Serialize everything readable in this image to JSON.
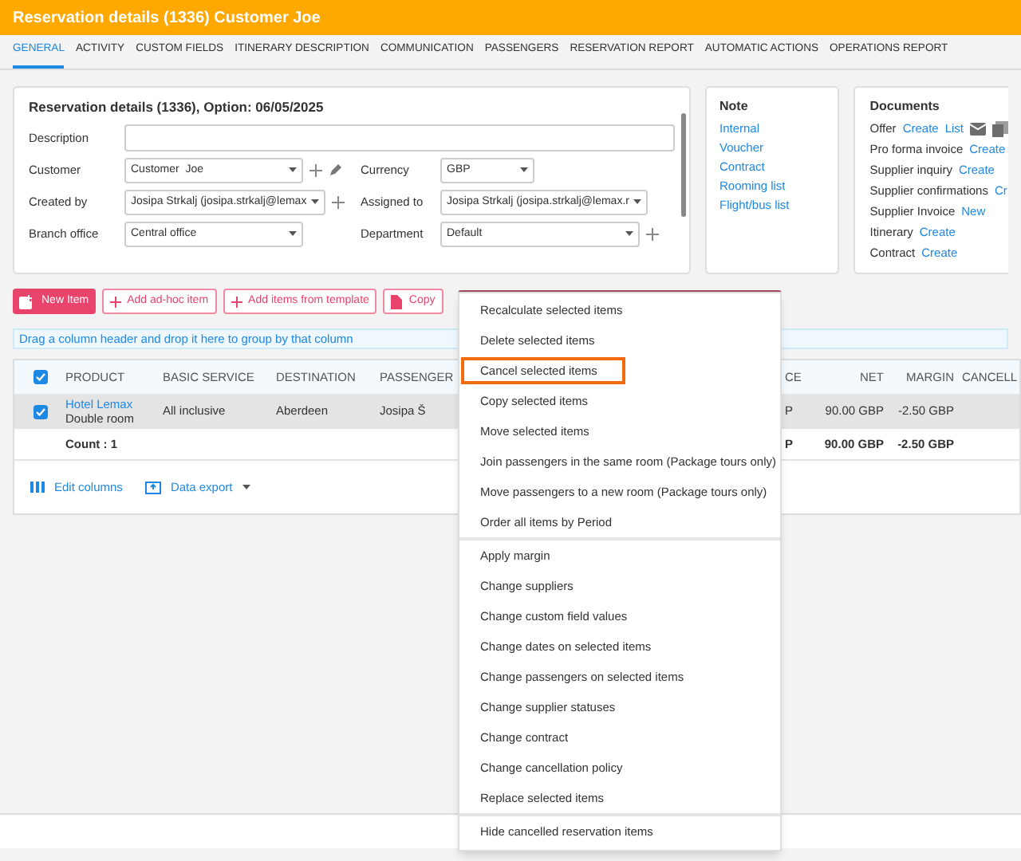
{
  "window": {
    "title": "Reservation details (1336) Customer Joe"
  },
  "tabs": [
    {
      "label": "GENERAL",
      "selected": true
    },
    {
      "label": "ACTIVITY",
      "selected": false
    },
    {
      "label": "CUSTOM FIELDS",
      "selected": false
    },
    {
      "label": "ITINERARY DESCRIPTION",
      "selected": false
    },
    {
      "label": "COMMUNICATION",
      "selected": false
    },
    {
      "label": "PASSENGERS",
      "selected": false
    },
    {
      "label": "RESERVATION REPORT",
      "selected": false
    },
    {
      "label": "AUTOMATIC ACTIONS",
      "selected": false
    },
    {
      "label": "OPERATIONS REPORT",
      "selected": false
    }
  ],
  "details": {
    "title": "Reservation details (1336), Option: 06/05/2025",
    "description": {
      "label": "Description"
    },
    "rows": [
      [
        {
          "label": "Customer",
          "kind": "select",
          "value": "Customer  Joe"
        },
        {
          "label": "Currency",
          "kind": "select",
          "value": "GBP"
        }
      ],
      [
        {
          "label": "Created by",
          "kind": "select",
          "value": "Josipa Strkalj (josipa.strkalj@lemax"
        },
        {
          "label": "Assigned to",
          "kind": "select",
          "value": "Josipa Strkalj (josipa.strkalj@lemax.r"
        }
      ],
      [
        {
          "label": "Branch office",
          "kind": "select",
          "value": "Central office"
        },
        {
          "label": "Department",
          "kind": "select",
          "value": "Default"
        }
      ]
    ]
  },
  "note": {
    "title": "Note",
    "links": [
      "Internal",
      "Voucher",
      "Contract",
      "Rooming list",
      "Flight/bus list"
    ]
  },
  "documents": {
    "title": "Documents",
    "items": [
      {
        "label": "Offer",
        "links": [
          "Create",
          "List"
        ]
      },
      {
        "label": "Pro forma invoice",
        "links": [
          "Create"
        ]
      },
      {
        "label": "Supplier inquiry",
        "links": [
          "Create"
        ]
      },
      {
        "label": "Supplier confirmations",
        "links": [
          "Cr"
        ]
      },
      {
        "label": "Supplier Invoice",
        "links": [
          "New"
        ]
      },
      {
        "label": "Itinerary",
        "links": [
          "Create"
        ]
      },
      {
        "label": "Contract",
        "links": [
          "Create"
        ]
      }
    ]
  },
  "toolbar": [
    {
      "label": "New Item",
      "kind": "primary"
    },
    {
      "label": "Add ad-hoc item",
      "kind": "outline"
    },
    {
      "label": "Add items from template",
      "kind": "outline"
    },
    {
      "label": "Copy",
      "kind": "outline"
    }
  ],
  "group_hint": "Drag a column header and drop it here to group by that column",
  "table": {
    "all_checked": true,
    "columns": [
      "PRODUCT",
      "BASIC SERVICE",
      "DESTINATION",
      "PASSENGER",
      "CE",
      "NET",
      "MARGIN",
      "CANCELL"
    ],
    "rows": [
      {
        "checked": true,
        "selected": true,
        "product": "Hotel Lemax",
        "room": "Double room",
        "basic_service": "All inclusive",
        "destination": "Aberdeen",
        "passenger": "Josipa Š",
        "column_5": "P",
        "net": "90.00 GBP",
        "margin": "-2.50 GBP"
      }
    ],
    "summary": {
      "count": "Count : 1",
      "column_5": "P",
      "net": "90.00 GBP",
      "margin": "-2.50 GBP"
    },
    "footer": [
      {
        "label": "Edit columns"
      },
      {
        "label": "Data export"
      }
    ]
  },
  "menu": [
    [
      {
        "label": "Recalculate selected items",
        "selected": false
      },
      {
        "label": "Delete selected items",
        "selected": false
      },
      {
        "label": "Cancel selected items",
        "selected": true
      },
      {
        "label": "Copy selected items",
        "selected": false
      },
      {
        "label": "Move selected items",
        "selected": false
      },
      {
        "label": "Join passengers in the same room (Package tours only)",
        "selected": false
      },
      {
        "label": "Move passengers to a new room (Package tours only)",
        "selected": false
      },
      {
        "label": "Order all items by Period",
        "selected": false
      }
    ],
    [
      {
        "label": "Apply margin",
        "selected": false
      },
      {
        "label": "Change suppliers",
        "selected": false
      },
      {
        "label": "Change custom field values",
        "selected": false
      },
      {
        "label": "Change dates on selected items",
        "selected": false
      },
      {
        "label": "Change passengers on selected items",
        "selected": false
      },
      {
        "label": "Change supplier statuses",
        "selected": false
      },
      {
        "label": "Change contract",
        "selected": false
      },
      {
        "label": "Change cancellation policy",
        "selected": false
      },
      {
        "label": "Replace selected items",
        "selected": false
      }
    ],
    [
      {
        "label": "Hide cancelled reservation items",
        "selected": false
      }
    ]
  ]
}
